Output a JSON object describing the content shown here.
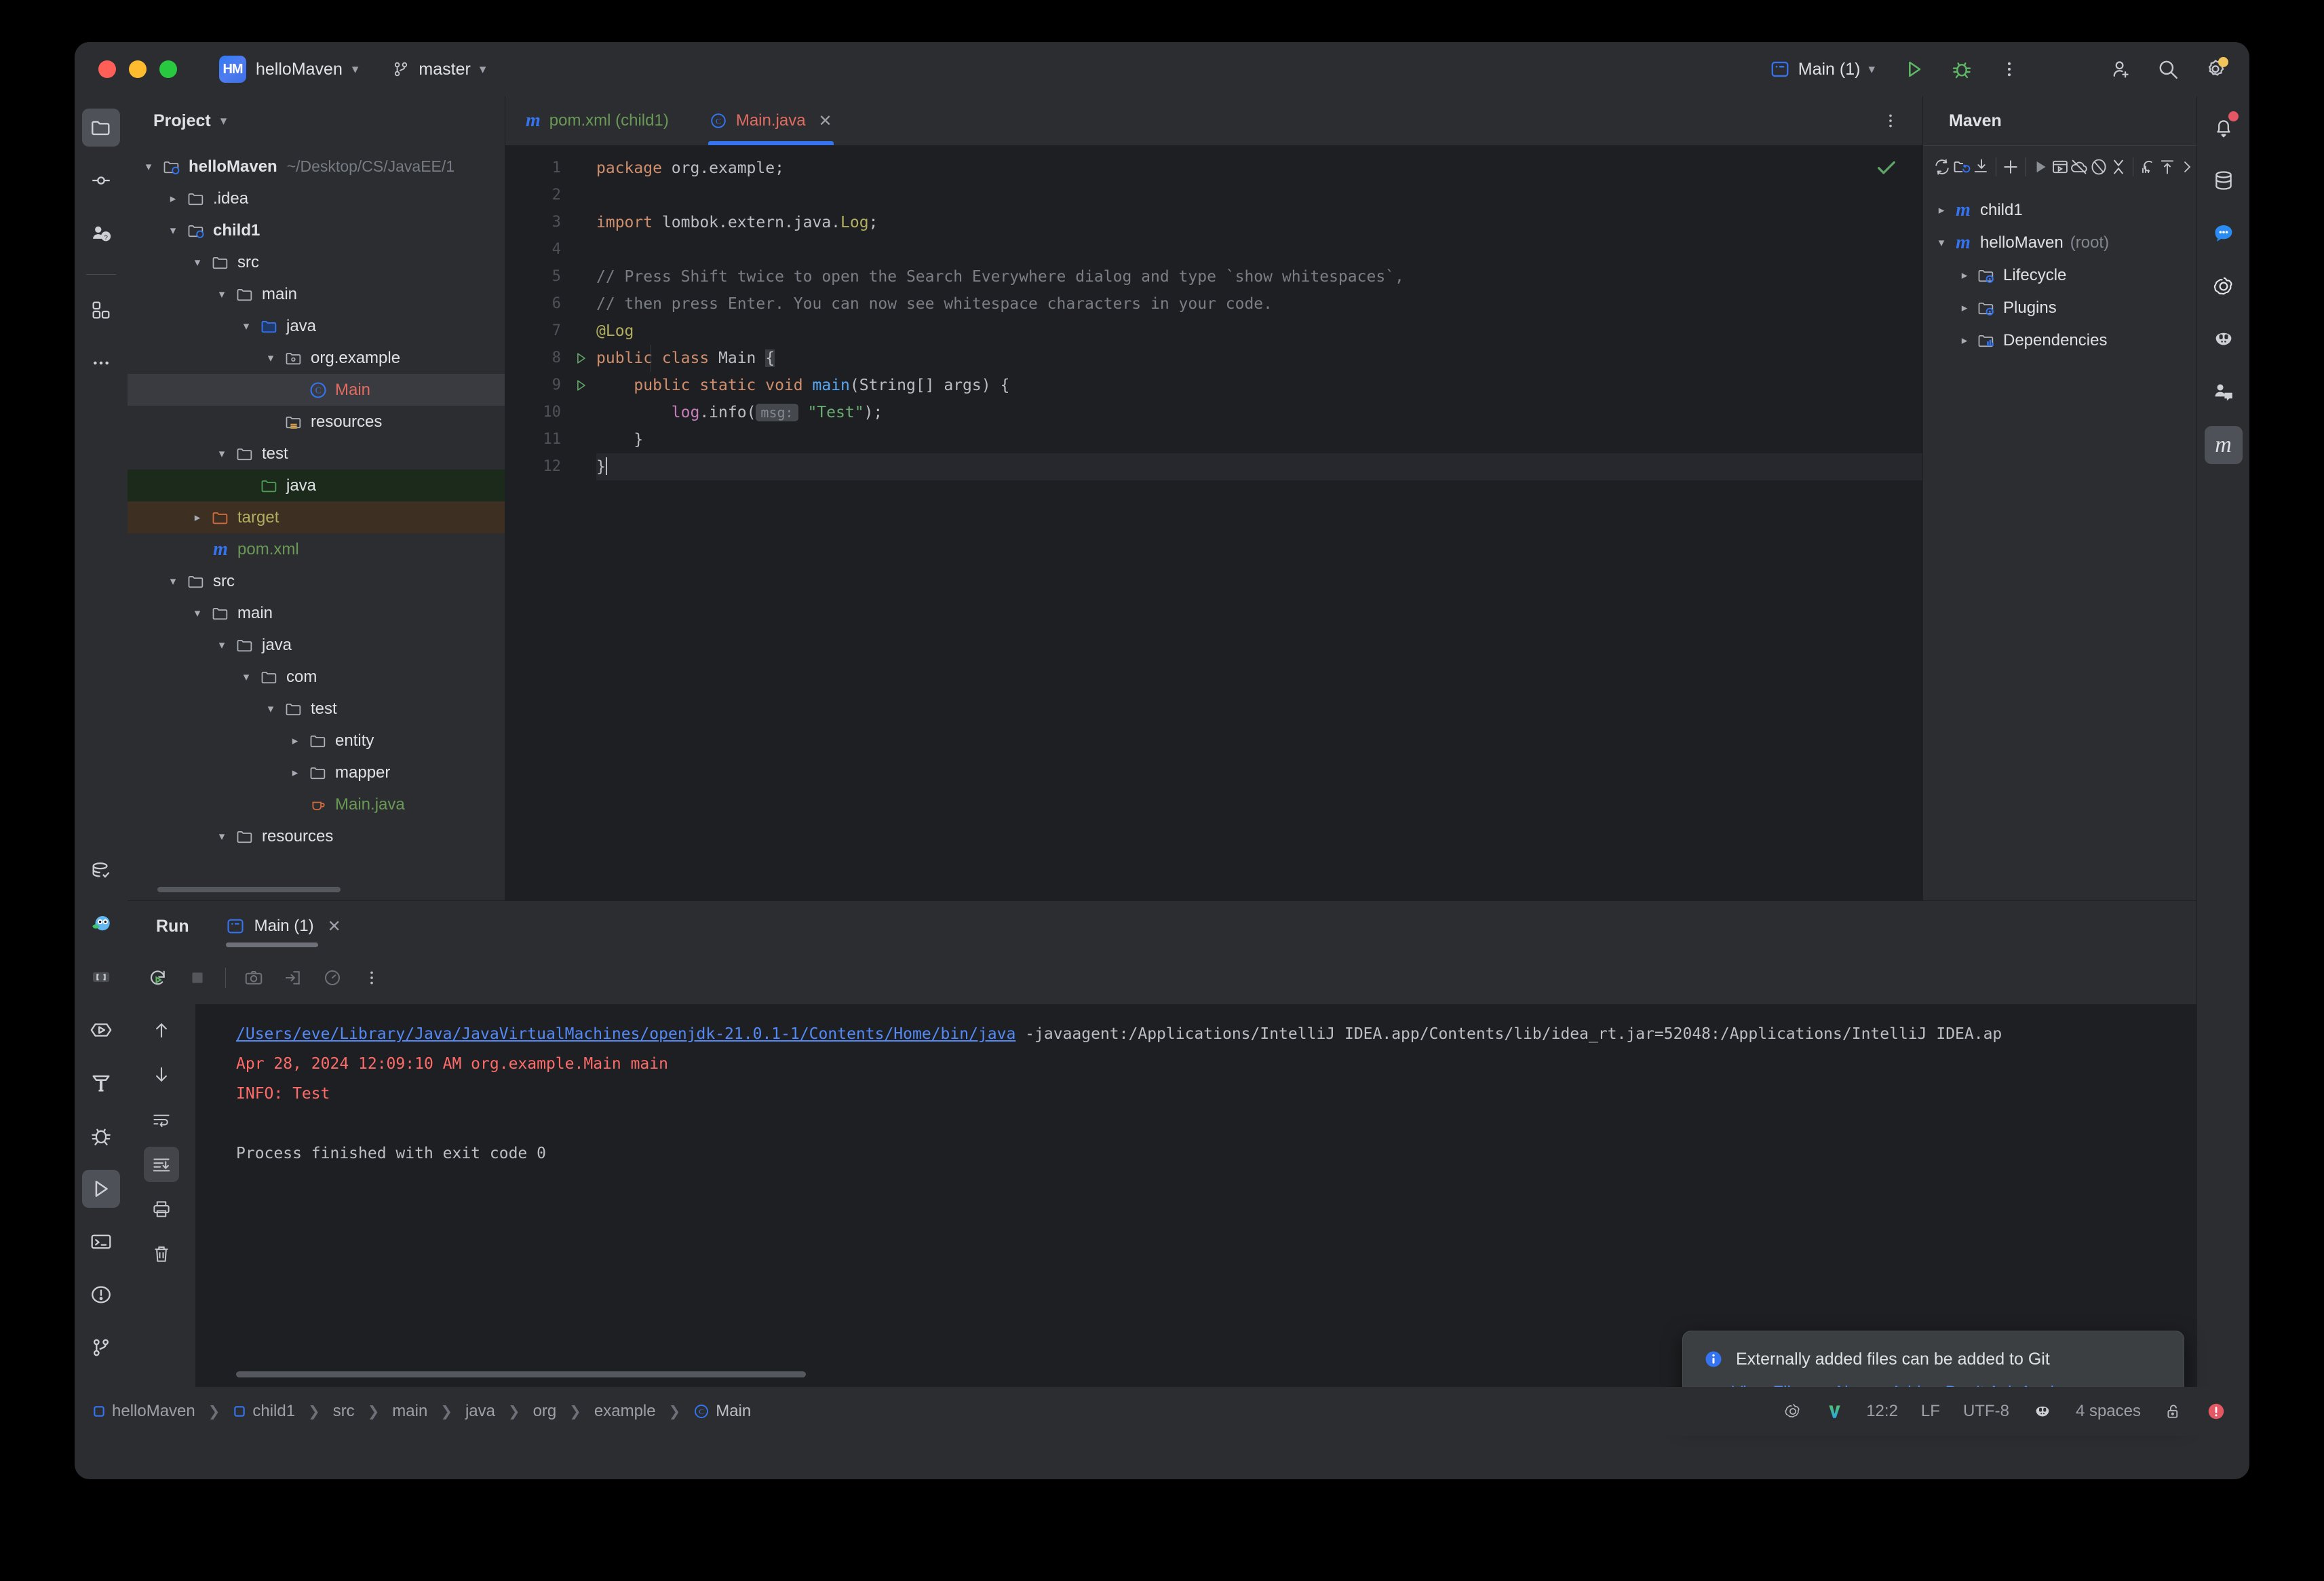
{
  "titlebar": {
    "project_badge": "HM",
    "project_name": "helloMaven",
    "branch": "master",
    "run_config": "Main (1)",
    "icons": [
      "run-icon",
      "debug-icon",
      "more-options-icon",
      "add-collaborator-icon",
      "search-icon",
      "settings-icon"
    ]
  },
  "left_stripe": {
    "top": [
      "project-folder-icon",
      "commit-icon",
      "pull-requests-icon",
      "plugins-icon",
      "more-tool-windows-icon"
    ],
    "bottom": [
      "database-check-icon",
      "go-owl-icon",
      "bookmarks-icon",
      "endpoints-icon",
      "build-icon",
      "debug-bug-icon",
      "run-icon",
      "terminal-icon",
      "problems-icon",
      "git-branch-icon"
    ]
  },
  "right_stripe": [
    "notifications-icon",
    "database-icon",
    "messages-icon",
    "ai-assistant-icon",
    "codeium-icon",
    "collaborate-icon",
    "maven-icon"
  ],
  "project": {
    "title": "Project",
    "tree": [
      {
        "depth": 0,
        "arrow": "down",
        "icon": "module-folder",
        "label": "helloMaven",
        "bold": true,
        "path": "~/Desktop/CS/JavaEE/1"
      },
      {
        "depth": 1,
        "arrow": "right",
        "icon": "folder",
        "label": ".idea"
      },
      {
        "depth": 1,
        "arrow": "down",
        "icon": "module-folder",
        "label": "child1",
        "bold": true
      },
      {
        "depth": 2,
        "arrow": "down",
        "icon": "folder",
        "label": "src"
      },
      {
        "depth": 3,
        "arrow": "down",
        "icon": "folder",
        "label": "main"
      },
      {
        "depth": 4,
        "arrow": "down",
        "icon": "source-folder",
        "label": "java"
      },
      {
        "depth": 5,
        "arrow": "down",
        "icon": "package",
        "label": "org.example"
      },
      {
        "depth": 6,
        "arrow": "none",
        "icon": "class",
        "label": "Main",
        "selected": true
      },
      {
        "depth": 5,
        "arrow": "none",
        "icon": "resource-folder",
        "label": "resources"
      },
      {
        "depth": 3,
        "arrow": "down",
        "icon": "folder",
        "label": "test"
      },
      {
        "depth": 4,
        "arrow": "none",
        "icon": "test-source-folder",
        "label": "java",
        "rowbg": "green"
      },
      {
        "depth": 2,
        "arrow": "right",
        "icon": "excluded-folder",
        "label": "target",
        "rowbg": "brown"
      },
      {
        "depth": 2,
        "arrow": "none",
        "icon": "maven-file",
        "label": "pom.xml"
      },
      {
        "depth": 1,
        "arrow": "down",
        "icon": "folder",
        "label": "src"
      },
      {
        "depth": 2,
        "arrow": "down",
        "icon": "folder",
        "label": "main"
      },
      {
        "depth": 3,
        "arrow": "down",
        "icon": "folder",
        "label": "java"
      },
      {
        "depth": 4,
        "arrow": "down",
        "icon": "folder",
        "label": "com"
      },
      {
        "depth": 5,
        "arrow": "down",
        "icon": "folder",
        "label": "test"
      },
      {
        "depth": 6,
        "arrow": "right",
        "icon": "folder",
        "label": "entity"
      },
      {
        "depth": 6,
        "arrow": "right",
        "icon": "folder",
        "label": "mapper"
      },
      {
        "depth": 6,
        "arrow": "none",
        "icon": "java-file",
        "label": "Main.java"
      },
      {
        "depth": 3,
        "arrow": "down",
        "icon": "folder",
        "label": "resources"
      }
    ]
  },
  "editor": {
    "tabs": [
      {
        "label": "pom.xml (child1)",
        "icon": "maven-file",
        "active": false
      },
      {
        "label": "Main.java",
        "icon": "class",
        "active": true,
        "closable": true
      }
    ],
    "inspection_status": "check-ok",
    "lines": [
      {
        "n": 1,
        "segments": [
          {
            "t": "package ",
            "c": "k"
          },
          {
            "t": "org.example;",
            "c": ""
          }
        ]
      },
      {
        "n": 2,
        "segments": []
      },
      {
        "n": 3,
        "segments": [
          {
            "t": "import ",
            "c": "k"
          },
          {
            "t": "lombok.extern.java.",
            "c": ""
          },
          {
            "t": "Log",
            "c": "an"
          },
          {
            "t": ";",
            "c": ""
          }
        ]
      },
      {
        "n": 4,
        "segments": []
      },
      {
        "n": 5,
        "segments": [
          {
            "t": "// Press Shift twice to open the Search Everywhere dialog and type `show whitespaces`,",
            "c": "cm"
          }
        ]
      },
      {
        "n": 6,
        "segments": [
          {
            "t": "// then press Enter. You can now see whitespace characters in your code.",
            "c": "cm"
          }
        ]
      },
      {
        "n": 7,
        "segments": [
          {
            "t": "@Log",
            "c": "an"
          }
        ]
      },
      {
        "n": 8,
        "gutter_run": true,
        "segments": [
          {
            "t": "public class ",
            "c": "k"
          },
          {
            "t": "Main ",
            "c": "cls"
          },
          {
            "t": "{",
            "c": "brmatch"
          }
        ]
      },
      {
        "n": 9,
        "gutter_run": true,
        "segments": [
          {
            "t": "    public static void ",
            "c": "k"
          },
          {
            "t": "main",
            "c": "mth"
          },
          {
            "t": "(String[] args) {",
            "c": ""
          }
        ]
      },
      {
        "n": 10,
        "segments": [
          {
            "t": "        ",
            "c": ""
          },
          {
            "t": "log",
            "c": "fld"
          },
          {
            "t": ".info(",
            "c": ""
          },
          {
            "t": "msg:",
            "c": "hint"
          },
          {
            "t": " ",
            "c": ""
          },
          {
            "t": "\"Test\"",
            "c": "st"
          },
          {
            "t": ");",
            "c": ""
          }
        ]
      },
      {
        "n": 11,
        "segments": [
          {
            "t": "    }",
            "c": ""
          }
        ]
      },
      {
        "n": 12,
        "highlight": true,
        "segments": [
          {
            "t": "}",
            "c": ""
          }
        ]
      }
    ]
  },
  "maven": {
    "title": "Maven",
    "toolbar_icons": [
      "reload-all-icon",
      "add-maven-project-icon",
      "download-sources-icon",
      "add-icon",
      "run-maven-goal-icon",
      "execute-icon",
      "offline-mode-icon",
      "skip-tests-icon",
      "collapse-all-icon",
      "profiler-icon",
      "expand-icon",
      "chevron-right-icon"
    ],
    "tree": [
      {
        "depth": 0,
        "arrow": "right",
        "icon": "maven-module",
        "label": "child1"
      },
      {
        "depth": 0,
        "arrow": "down",
        "icon": "maven-module",
        "label": "helloMaven",
        "suffix": "(root)"
      },
      {
        "depth": 1,
        "arrow": "right",
        "icon": "lifecycle-folder",
        "label": "Lifecycle"
      },
      {
        "depth": 1,
        "arrow": "right",
        "icon": "plugins-folder",
        "label": "Plugins"
      },
      {
        "depth": 1,
        "arrow": "right",
        "icon": "dependencies-folder",
        "label": "Dependencies"
      }
    ]
  },
  "run": {
    "title": "Run",
    "tab_label": "Main (1)",
    "left_tools": [
      "scroll-up-icon",
      "scroll-down-icon",
      "soft-wrap-icon",
      "scroll-to-end-icon",
      "print-icon",
      "clear-all-icon"
    ],
    "top_tools": [
      "rerun-icon",
      "stop-icon",
      "screenshot-icon",
      "export-icon",
      "profiler-icon",
      "more-options-icon"
    ],
    "console": [
      {
        "type": "link_and_text",
        "link": "/Users/eve/Library/Java/JavaVirtualMachines/openjdk-21.0.1-1/Contents/Home/bin/java",
        "text": " -javaagent:/Applications/IntelliJ IDEA.app/Contents/lib/idea_rt.jar=52048:/Applications/IntelliJ IDEA.ap"
      },
      {
        "type": "error",
        "text": "Apr 28, 2024 12:09:10 AM org.example.Main main"
      },
      {
        "type": "error",
        "text": "INFO: Test"
      },
      {
        "type": "blank",
        "text": ""
      },
      {
        "type": "normal",
        "text": "Process finished with exit code 0"
      }
    ]
  },
  "notification": {
    "icon": "info-icon",
    "message": "Externally added files can be added to Git",
    "actions": [
      "View Files",
      "Always Add",
      "Don't Ask Again"
    ]
  },
  "statusbar": {
    "breadcrumb": [
      {
        "label": "helloMaven",
        "icon": "module"
      },
      {
        "label": "child1",
        "icon": "module"
      },
      {
        "label": "src"
      },
      {
        "label": "main"
      },
      {
        "label": "java"
      },
      {
        "label": "org"
      },
      {
        "label": "example"
      },
      {
        "label": "Main",
        "icon": "class"
      }
    ],
    "right": {
      "icons_left": [
        "ai-assistant-icon",
        "codeium-v-icon"
      ],
      "caret_position": "12:2",
      "line_separator": "LF",
      "encoding": "UTF-8",
      "codeium_icon": "codeium-icon",
      "indent": "4 spaces",
      "lock_icon": "unlock-icon",
      "error_icon": "error-badge-icon"
    }
  },
  "colors": {
    "accent_blue": "#3574f0",
    "link_blue": "#548af7",
    "error_red": "#ff6b68",
    "string_green": "#6aab73",
    "keyword_orange": "#cf8e6d",
    "panel_bg": "#2b2d30",
    "editor_bg": "#1e1f22"
  }
}
